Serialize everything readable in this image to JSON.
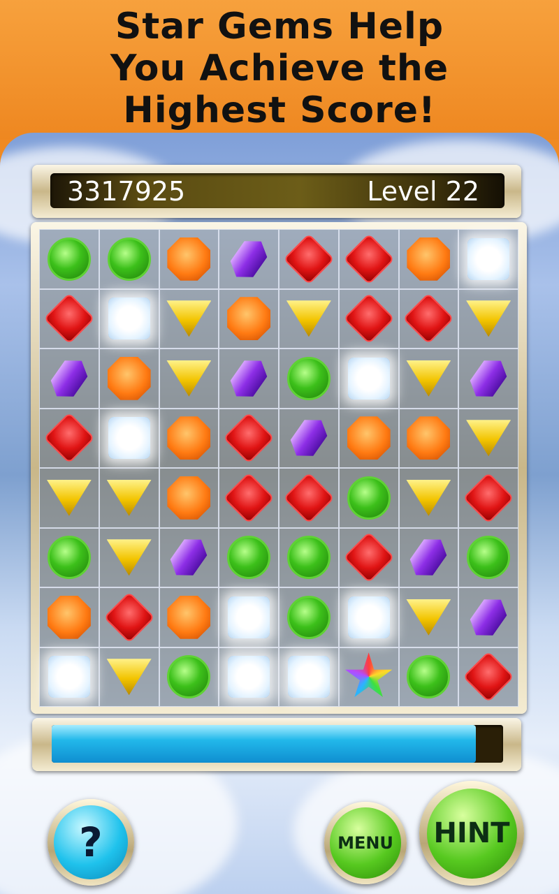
{
  "banner": {
    "line1": "Star Gems Help",
    "line2": "You Achieve the",
    "line3": "Highest Score!"
  },
  "hud": {
    "score": "3317925",
    "level": "Level 22"
  },
  "board": {
    "rows": [
      [
        "green",
        "green",
        "orange",
        "purple",
        "red",
        "red",
        "orange",
        "white"
      ],
      [
        "red",
        "white",
        "yellow",
        "orange",
        "yellow",
        "red",
        "red",
        "yellow"
      ],
      [
        "purple",
        "orange",
        "yellow",
        "purple",
        "green",
        "white",
        "yellow",
        "purple"
      ],
      [
        "red",
        "white",
        "orange",
        "red",
        "purple",
        "orange",
        "orange",
        "yellow"
      ],
      [
        "yellow",
        "yellow",
        "orange",
        "red",
        "red",
        "green",
        "yellow",
        "red"
      ],
      [
        "green",
        "yellow",
        "purple",
        "green",
        "green",
        "red",
        "purple",
        "green"
      ],
      [
        "orange",
        "red",
        "orange",
        "white",
        "green",
        "white",
        "yellow",
        "purple"
      ],
      [
        "white",
        "yellow",
        "green",
        "white",
        "white",
        "star",
        "green",
        "red"
      ]
    ]
  },
  "progress": {
    "fraction": 0.94
  },
  "buttons": {
    "help_label": "?",
    "menu_label": "MENU",
    "hint_label": "HINT"
  }
}
